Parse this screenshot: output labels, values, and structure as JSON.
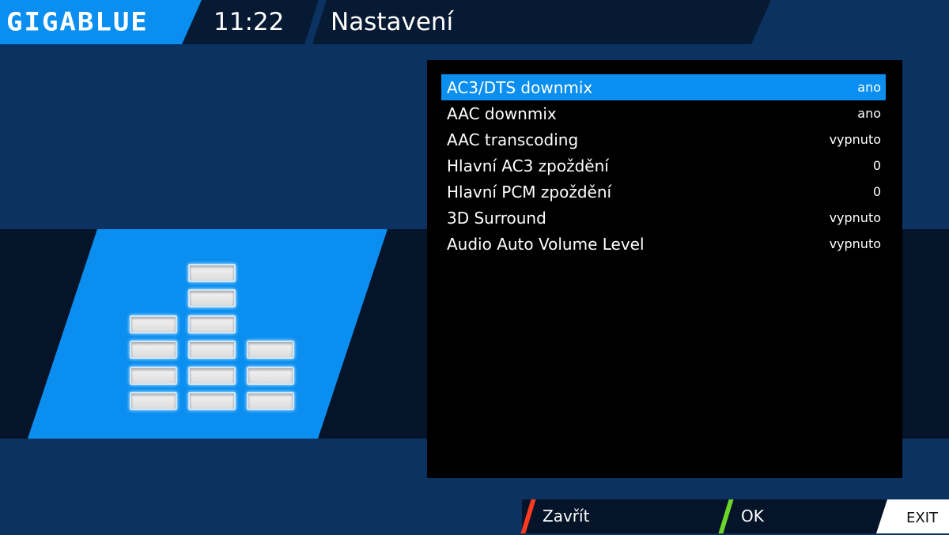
{
  "header": {
    "brand": "GIGABLUE",
    "clock": "11:22",
    "title": "Nastavení"
  },
  "settings": [
    {
      "label": "AC3/DTS downmix",
      "value": "ano",
      "selected": true
    },
    {
      "label": "AAC downmix",
      "value": "ano"
    },
    {
      "label": "AAC transcoding",
      "value": "vypnuto"
    },
    {
      "label": "Hlavní AC3 zpoždění",
      "value": "0"
    },
    {
      "label": "Hlavní PCM zpoždění",
      "value": "0"
    },
    {
      "label": "3D Surround",
      "value": "vypnuto"
    },
    {
      "label": "Audio Auto Volume Level",
      "value": "vypnuto"
    }
  ],
  "buttons": {
    "red": "Zavřít",
    "green": "OK",
    "exit": "EXIT"
  },
  "icon": {
    "name": "audio-equalizer-icon",
    "bar_levels": [
      4,
      6,
      3
    ]
  },
  "colors": {
    "accent": "#0a8ff0",
    "background": "#0b3260",
    "red_key": "#ff3a1f",
    "green_key": "#6cd62a"
  }
}
